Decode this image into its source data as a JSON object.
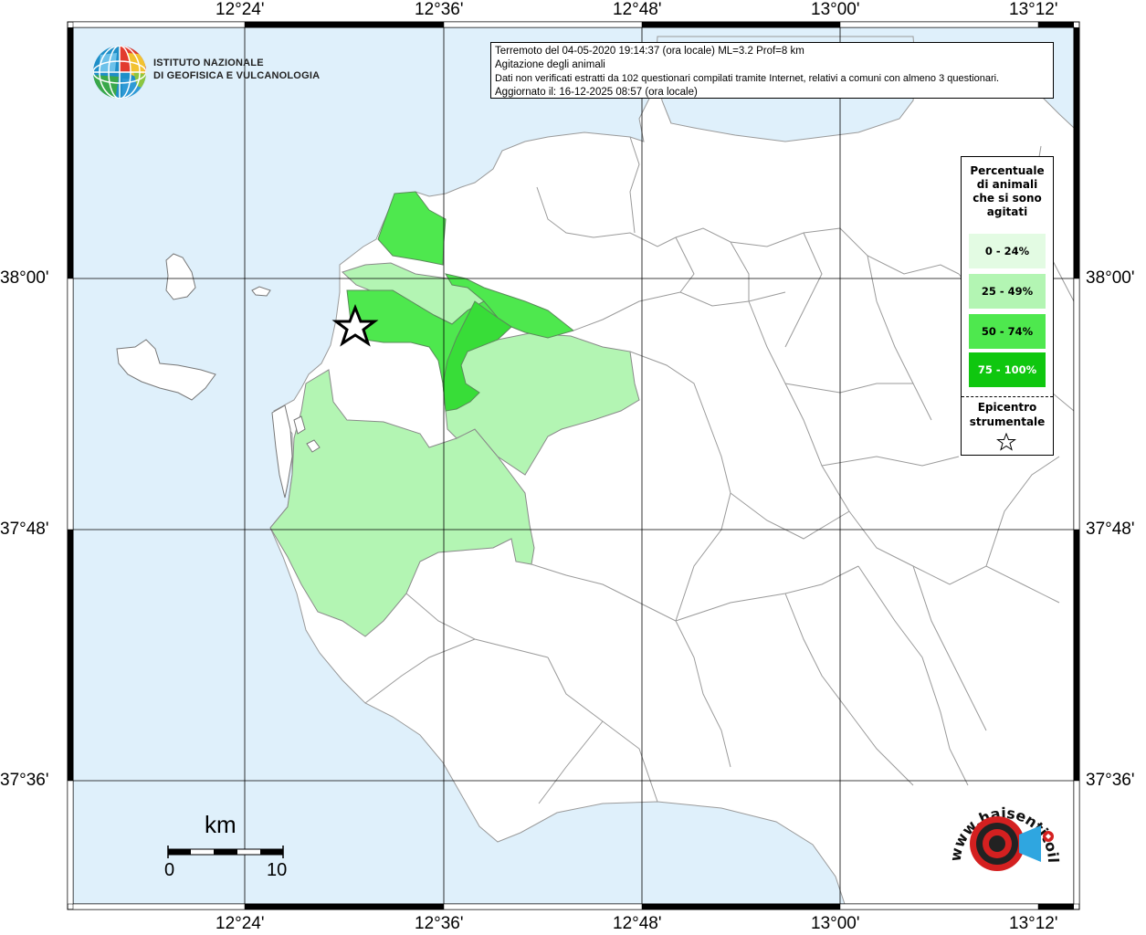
{
  "info": {
    "line1": "Terremoto del 04-05-2020 19:14:37 (ora locale) ML=3.2 Prof=8 km",
    "line2": "Agitazione degli animali",
    "line3": "Dati non verificati estratti da 102 questionari compilati tramite Internet, relativi a comuni con almeno 3 questionari.",
    "line4": "Aggiornato il: 16-12-2025 08:57 (ora locale)"
  },
  "institute": {
    "line1": "ISTITUTO NAZIONALE",
    "line2": "DI GEOFISICA E VULCANOLOGIA"
  },
  "axes": {
    "lon_ticks": [
      "12°24'",
      "12°36'",
      "12°48'",
      "13°00'",
      "13°12'"
    ],
    "lat_ticks": [
      "38°00'",
      "37°48'",
      "37°36'"
    ]
  },
  "legend": {
    "title_lines": [
      "Percentuale",
      "di animali",
      "che si sono",
      "agitati"
    ],
    "classes": [
      {
        "label": "0 - 24%",
        "color": "#e3fbe3"
      },
      {
        "label": "25 - 49%",
        "color": "#b3f5b3"
      },
      {
        "label": "50 - 74%",
        "color": "#4ee84e"
      },
      {
        "label": "75 - 100%",
        "color": "#0fc70f"
      }
    ],
    "epicenter_lines": [
      "Epicentro",
      "strumentale"
    ]
  },
  "scale": {
    "unit": "km",
    "label_start": "0",
    "label_end": "10"
  },
  "watermark": {
    "text": "www.haisentitoilterremoto.it"
  },
  "colors": {
    "sea": "#dff0fb",
    "land": "#ffffff",
    "grid": "#000000"
  }
}
